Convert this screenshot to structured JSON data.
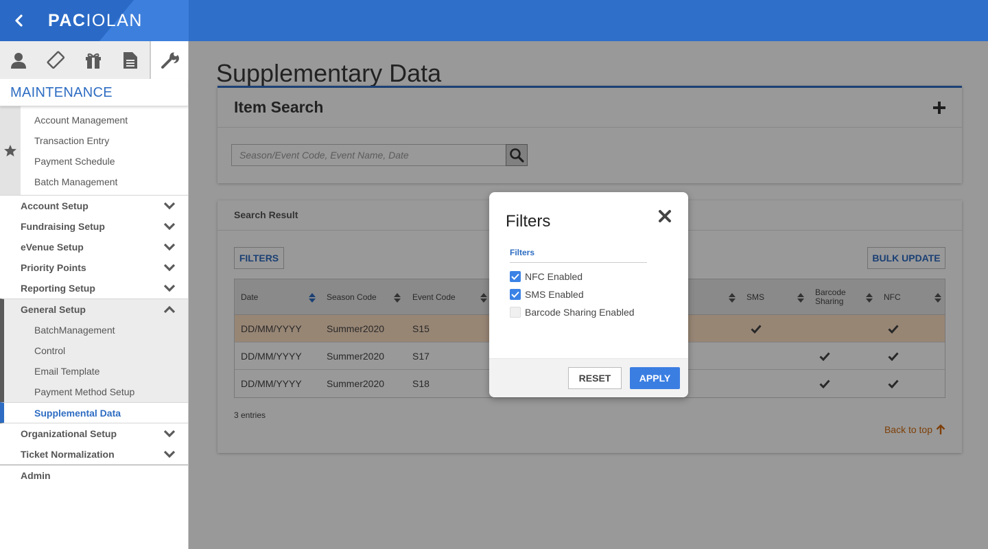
{
  "brand": {
    "name_bold": "PAC",
    "name_rest": "IOLAN"
  },
  "sidebar": {
    "tabs": [
      "person-icon",
      "ticket-icon",
      "gift-icon",
      "document-icon",
      "wrench-icon"
    ],
    "section_title": "MAINTENANCE",
    "favorites": [
      "Account Management",
      "Transaction Entry",
      "Payment Schedule",
      "Batch Management"
    ],
    "menu": [
      {
        "label": "Account Setup"
      },
      {
        "label": "Fundraising Setup"
      },
      {
        "label": "eVenue Setup"
      },
      {
        "label": "Priority Points"
      },
      {
        "label": "Reporting Setup"
      }
    ],
    "general_setup": {
      "label": "General Setup",
      "items": [
        "BatchManagement",
        "Control",
        "Email Template",
        "Payment Method Setup",
        "Supplemental Data"
      ]
    },
    "menu_after": [
      {
        "label": "Organizational Setup"
      },
      {
        "label": "Ticket Normalization"
      }
    ],
    "admin": "Admin"
  },
  "main": {
    "page_title": "Supplementary Data",
    "item_search": {
      "title": "Item Search",
      "placeholder": "Season/Event Code, Event Name, Date"
    },
    "search_result": {
      "title": "Search Result",
      "filters_button": "FILTERS",
      "bulk_update_button": "BULK UPDATE",
      "columns": [
        "Date",
        "Season Code",
        "Event Code",
        "SMS",
        "Barcode Sharing",
        "NFC"
      ],
      "rows": [
        {
          "date": "DD/MM/YYYY",
          "season": "Summer2020",
          "event": "S15",
          "sms": true,
          "barcode": false,
          "nfc": true
        },
        {
          "date": "DD/MM/YYYY",
          "season": "Summer2020",
          "event": "S17",
          "sms": false,
          "barcode": true,
          "nfc": true
        },
        {
          "date": "DD/MM/YYYY",
          "season": "Summer2020",
          "event": "S18",
          "sms": false,
          "barcode": true,
          "nfc": true
        }
      ],
      "entries": "3 entries",
      "back_to_top": "Back to top"
    }
  },
  "modal": {
    "title": "Filters",
    "section_label": "Filters",
    "options": [
      {
        "label": "NFC Enabled",
        "checked": true
      },
      {
        "label": "SMS Enabled",
        "checked": true
      },
      {
        "label": "Barcode Sharing Enabled",
        "checked": false
      }
    ],
    "reset_button": "RESET",
    "apply_button": "APPLY"
  },
  "colors": {
    "brand_blue": "#2f6fc9",
    "accent_blue": "#2d6cc2",
    "row_highlight": "#fde0c3",
    "back_to_top": "#d26a0e"
  }
}
